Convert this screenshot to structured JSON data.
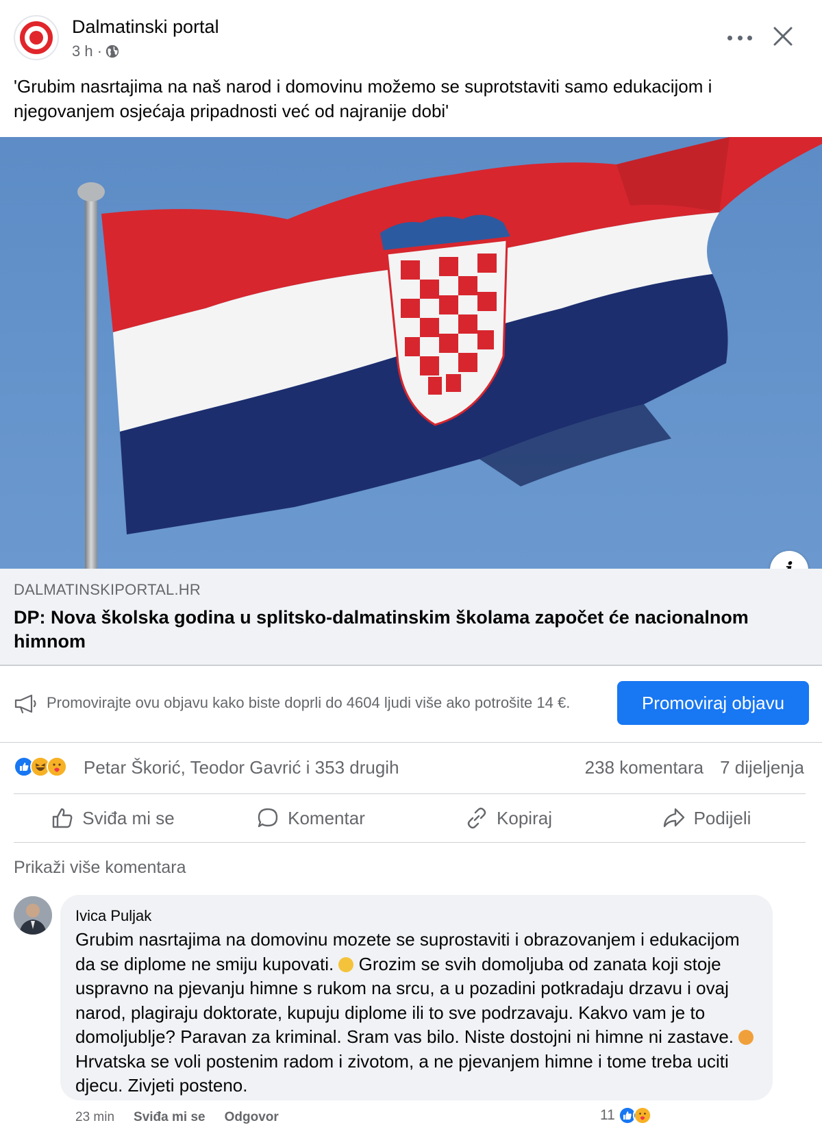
{
  "post": {
    "page_name": "Dalmatinski portal",
    "time": "3 h ·",
    "text": "'Grubim nasrtajima na naš narod i domovinu možemo se suprotstaviti samo edukacijom i njegovanjem osjećaja pripadnosti već od najranije dobi'",
    "link_domain": "DALMATINSKIPORTAL.HR",
    "link_title": "DP: Nova školska godina u splitsko-dalmatinskim školama započet će nacionalnom himnom",
    "info_label": "i"
  },
  "promo": {
    "text": "Promovirajte ovu objavu kako biste doprli do 4604 ljudi više ako potrošite 14 €.",
    "button": "Promoviraj objavu"
  },
  "summary": {
    "reactors": "Petar Škorić, Teodor Gavrić i 353 drugih",
    "comments": "238 komentara",
    "shares": "7 dijeljenja"
  },
  "actions": {
    "like": "Sviđa mi se",
    "comment": "Komentar",
    "copy": "Kopiraj",
    "share": "Podijeli"
  },
  "more_comments": "Prikaži više komentara",
  "comment": {
    "author": "Ivica Puljak",
    "text_1": "Grubim nasrtajima na domovinu mozete se suprostaviti i obrazovanjem i edukacijom da se diplome ne smiju kupovati.",
    "text_2": "Grozim se svih domoljuba od zanata koji stoje uspravno na pjevanju himne s rukom na srcu, a u pozadini potkradaju drzavu i ovaj narod, plagiraju doktorate, kupuju diplome ili to sve podrzavaju. Kakvo vam je to domoljublje? Paravan za kriminal. Sram vas bilo. Niste dostojni ni himne ni zastave.",
    "text_3": "Hrvatska se voli postenim radom i zivotom, a ne pjevanjem himne i tome treba uciti djecu. Zivjeti posteno.",
    "time": "23 min",
    "like": "Sviđa mi se",
    "reply": "Odgovor",
    "reaction_count": "11"
  },
  "colors": {
    "accent": "#1877f2",
    "flag_red": "#d7262e",
    "flag_white": "#f4f4f4",
    "flag_blue": "#1d2e6e",
    "sky": "#5d8cc6"
  }
}
